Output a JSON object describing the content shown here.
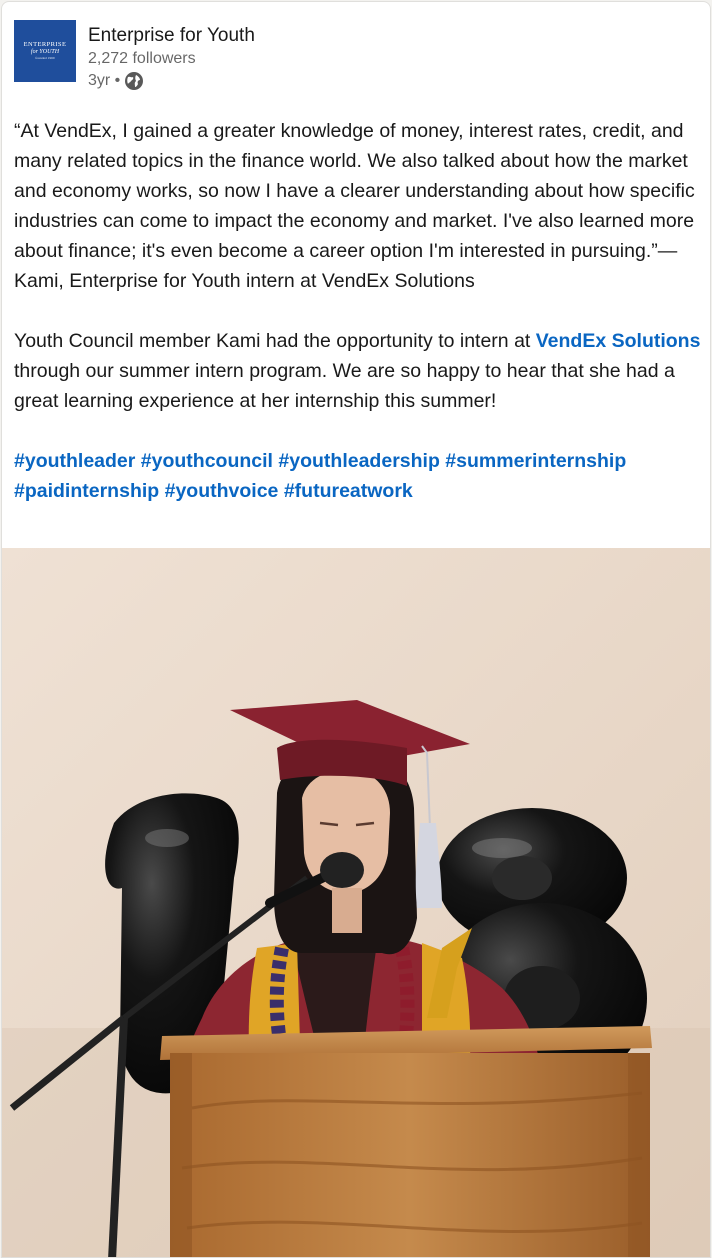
{
  "post": {
    "actor": {
      "logo_text": {
        "line1": "ENTERPRISE",
        "line2": "for YOUTH",
        "line3": "founded 1969"
      },
      "name": "Enterprise for Youth",
      "followers": "2,272 followers",
      "age": "3yr •",
      "visibility_icon": "globe-icon"
    },
    "text": {
      "quote": "“At VendEx, I gained a greater knowledge of money, interest rates, credit, and many related topics in the finance world. We also talked about how the market and economy works, so now I have a clearer understanding about how specific industries can come to impact the economy and market. I've also learned more about finance; it's even become a career option I'm interested in pursuing.”—Kami, Enterprise for Youth intern at VendEx Solutions",
      "para2_before": "Youth Council member Kami had the opportunity to intern at ",
      "para2_link": "VendEx Solutions",
      "para2_after": " through our summer intern program. We are so happy to hear that she had a great learning experience at her internship this summer!",
      "hashtags": [
        "#youthleader",
        "#youthcouncil",
        "#youthleadership",
        "#summerinternship",
        "#paidinternship",
        "#youthvoice",
        "#futureatwork"
      ]
    },
    "image": {
      "subject": "graduate-speaking-at-podium-photo"
    },
    "colors": {
      "link": "#0a66c2",
      "logo_bg": "#1f4e9c"
    }
  }
}
